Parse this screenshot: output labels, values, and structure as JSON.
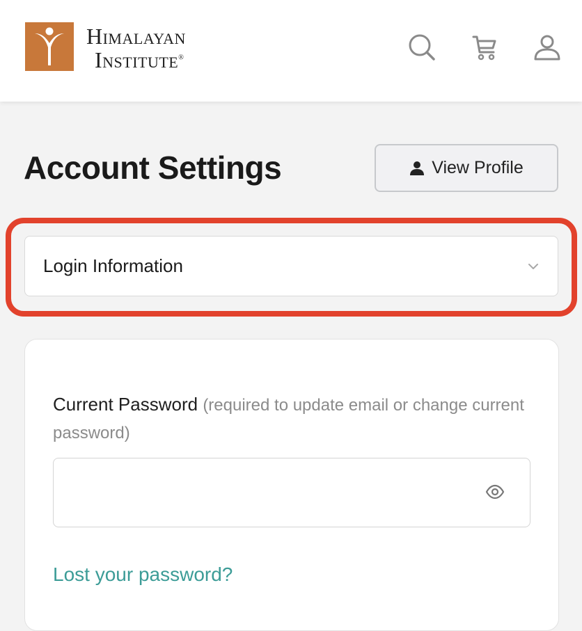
{
  "brand": {
    "name_line1": "Himalayan",
    "name_line2": "Institute",
    "registered_mark": "®",
    "logo_color": "#c8783a"
  },
  "header": {
    "icons": [
      "search-icon",
      "cart-icon",
      "user-icon"
    ]
  },
  "main": {
    "title": "Account Settings",
    "view_profile_label": "View Profile",
    "section_select": {
      "selected": "Login Information"
    },
    "form": {
      "current_password_label": "Current Password",
      "current_password_hint": "(required to update email or change current password)",
      "current_password_value": "",
      "lost_password_link": "Lost your password?"
    }
  },
  "colors": {
    "highlight": "#e2422c",
    "link": "#3c9c97",
    "background": "#f3f3f3"
  }
}
